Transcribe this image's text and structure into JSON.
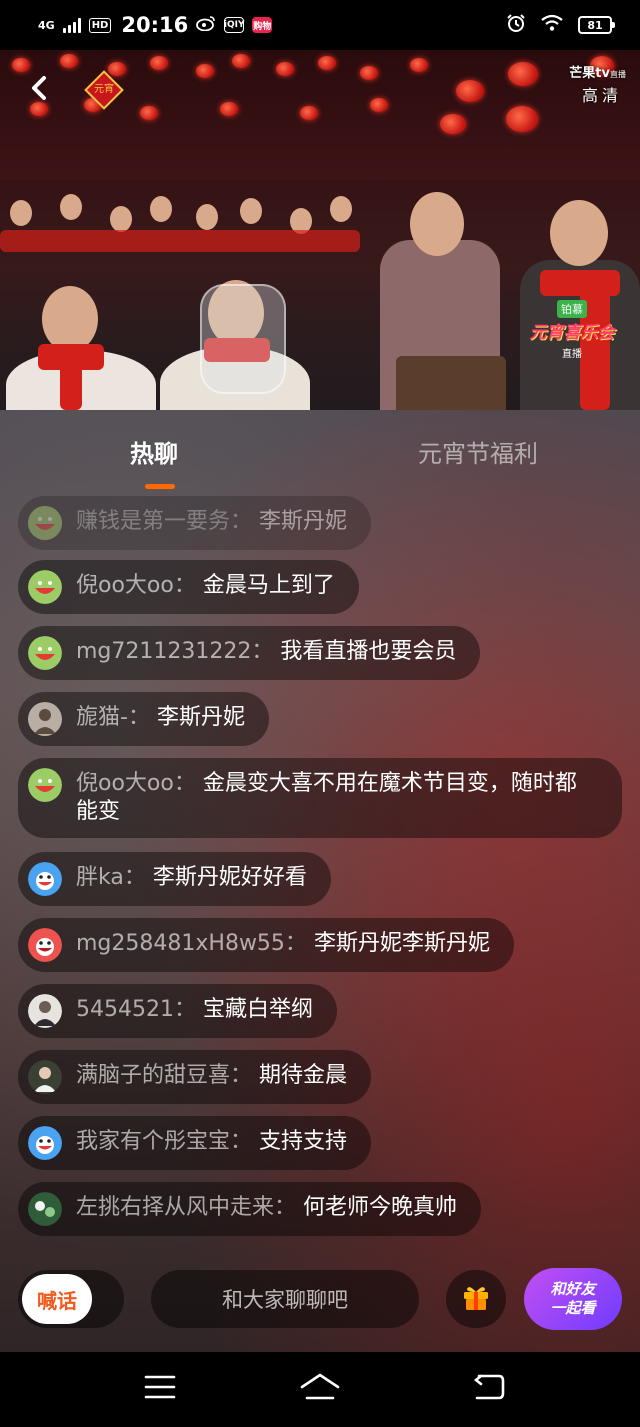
{
  "status_bar": {
    "network": "4G",
    "hd": "HD",
    "time": "20:16",
    "battery": "81",
    "app_icons": [
      "weibo-icon",
      "iqiyi-icon",
      "app-icon"
    ],
    "app_labels": [
      "iQIY",
      "购物"
    ]
  },
  "video": {
    "badge": "元宵",
    "channel": "芒果tv",
    "channel_sub": "直播",
    "quality": "高清",
    "show_tag": "铂慕",
    "show_name": "元宵喜乐会",
    "live_label": "直播"
  },
  "tabs": {
    "hot_chat": "热聊",
    "lantern_welfare": "元宵节福利"
  },
  "messages": [
    {
      "user": "赚钱是第一要务：",
      "text": "李斯丹妮",
      "avatar": "mango-avatar-icon",
      "faded": true
    },
    {
      "user": "倪oo大oo：",
      "text": "金晨马上到了",
      "avatar": "mango-avatar-icon"
    },
    {
      "user": "mg7211231222：",
      "text": "我看直播也要会员",
      "avatar": "mango-avatar-icon"
    },
    {
      "user": "旎猫-：",
      "text": "李斯丹妮",
      "avatar": "photo-avatar-icon"
    },
    {
      "user": "倪oo大oo：",
      "text": "金晨变大喜不用在魔术节目变，随时都能变",
      "avatar": "mango-avatar-icon"
    },
    {
      "user": "胖ka：",
      "text": "李斯丹妮好好看",
      "avatar": "blue-avatar-icon"
    },
    {
      "user": "mg258481xH8w55：",
      "text": "李斯丹妮李斯丹妮",
      "avatar": "red-avatar-icon"
    },
    {
      "user": "5454521：",
      "text": "宝藏白举纲",
      "avatar": "photo-avatar-icon"
    },
    {
      "user": "满脑子的甜豆喜：",
      "text": "期待金晨",
      "avatar": "photo-avatar-icon"
    },
    {
      "user": "我家有个彤宝宝：",
      "text": "支持支持",
      "avatar": "blue-avatar-icon"
    },
    {
      "user": "左挑右择从风中走来：",
      "text": "何老师今晚真帅",
      "avatar": "photo-avatar-icon"
    }
  ],
  "bottom_bar": {
    "shout": "喊话",
    "input_placeholder": "和大家聊聊吧",
    "watch_together_line1": "和好友",
    "watch_together_line2": "一起看"
  },
  "colors": {
    "accent": "#ff6a00",
    "shout_text": "#f25a1e",
    "watch_gradient_start": "#c24ff2",
    "watch_gradient_end": "#6f3cff"
  }
}
